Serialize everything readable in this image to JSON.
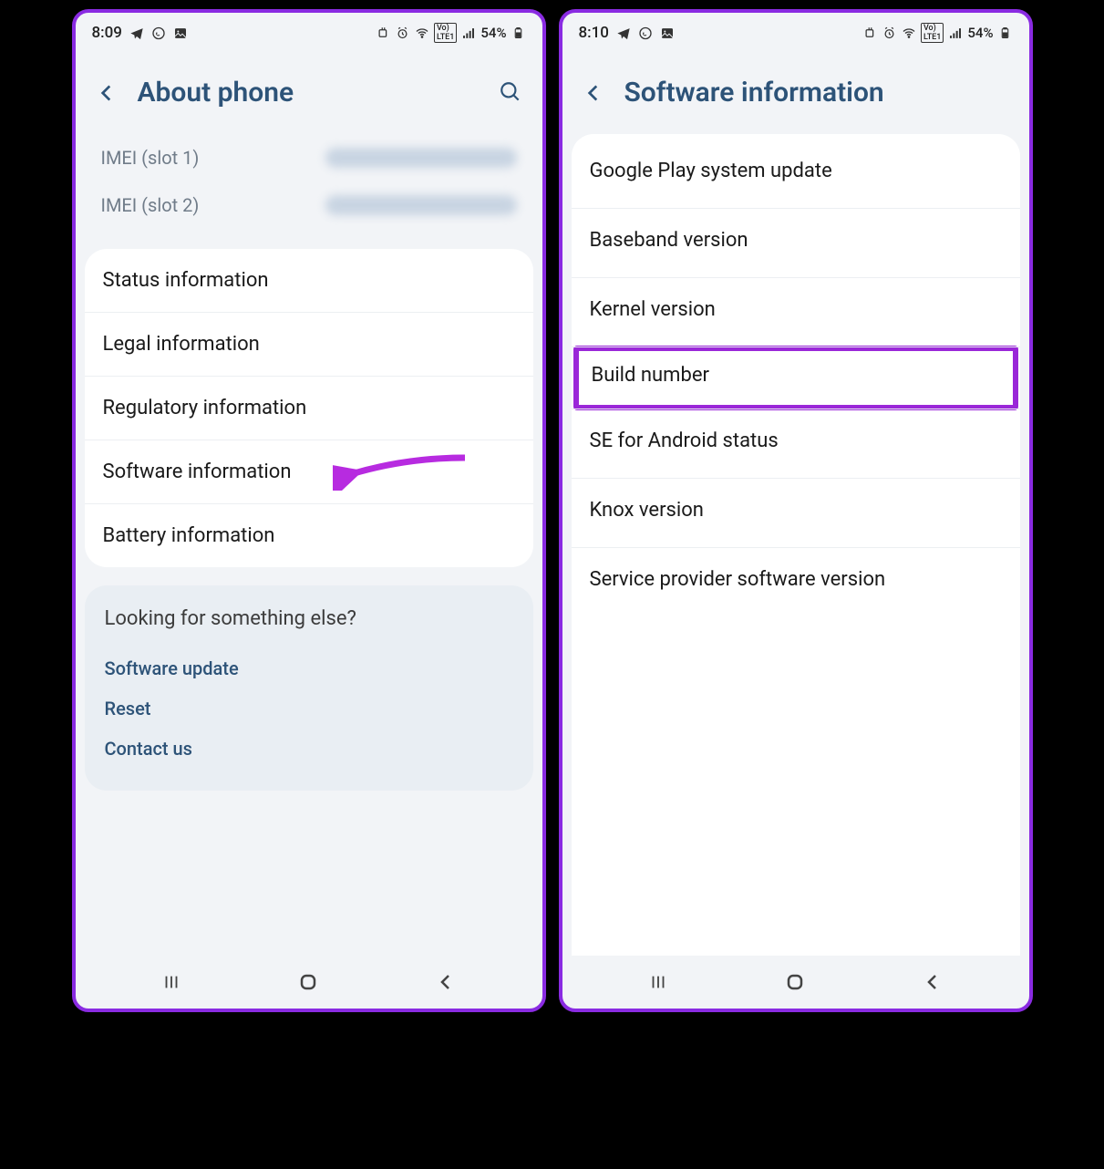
{
  "left": {
    "status": {
      "time": "8:09",
      "battery": "54%"
    },
    "title": "About phone",
    "imei1_label": "IMEI (slot 1)",
    "imei2_label": "IMEI (slot 2)",
    "rows": {
      "status_info": "Status information",
      "legal_info": "Legal information",
      "regulatory_info": "Regulatory information",
      "software_info": "Software information",
      "battery_info": "Battery information"
    },
    "suggest": {
      "heading": "Looking for something else?",
      "link1": "Software update",
      "link2": "Reset",
      "link3": "Contact us"
    }
  },
  "right": {
    "status": {
      "time": "8:10",
      "battery": "54%"
    },
    "title": "Software information",
    "rows": {
      "gplay": "Google Play system update",
      "baseband": "Baseband version",
      "kernel": "Kernel version",
      "build": "Build number",
      "se": "SE for Android status",
      "knox": "Knox version",
      "spv": "Service provider software version"
    }
  },
  "annotation": {
    "arrow_color": "#b72be0",
    "highlight_color": "#9a27d8"
  }
}
